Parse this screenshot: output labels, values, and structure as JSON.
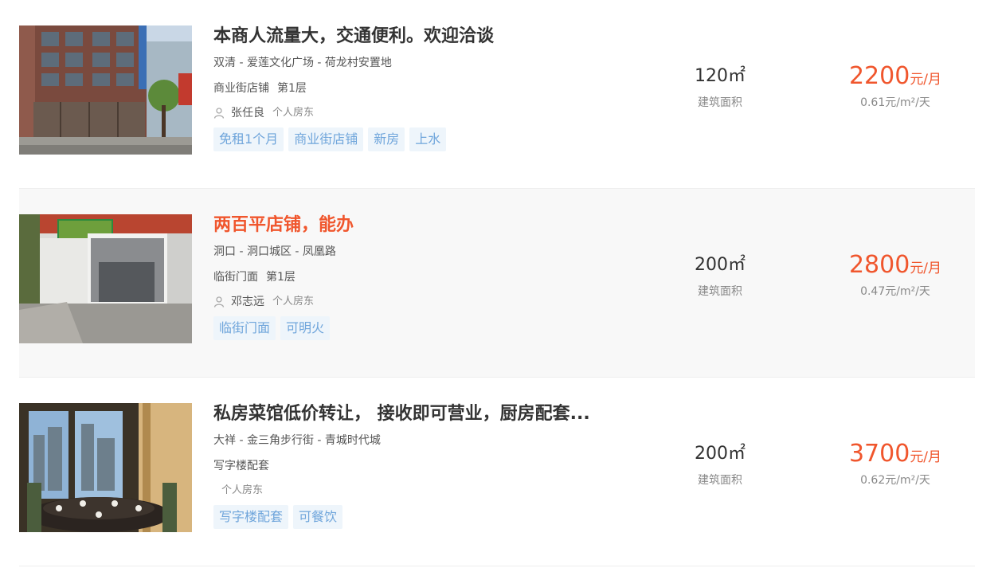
{
  "listings": [
    {
      "title": "本商人流量大，交通便利。欢迎洽谈",
      "address": "双清 - 爱莲文化广场 - 荷龙村安置地",
      "shop_type": "商业街店铺",
      "floor": "第1层",
      "owner_name": "张任良",
      "owner_type": "个人房东",
      "tags": [
        "免租1个月",
        "商业街店铺",
        "新房",
        "上水"
      ],
      "area": "120㎡",
      "area_label": "建筑面积",
      "price": "2200",
      "price_unit": "元/月",
      "unit_price": "0.61元/m²/天"
    },
    {
      "title": "两百平店铺，能办",
      "address": "洞口 - 洞口城区 - 凤凰路",
      "shop_type": "临街门面",
      "floor": "第1层",
      "owner_name": "邓志远",
      "owner_type": "个人房东",
      "tags": [
        "临街门面",
        "可明火"
      ],
      "area": "200㎡",
      "area_label": "建筑面积",
      "price": "2800",
      "price_unit": "元/月",
      "unit_price": "0.47元/m²/天"
    },
    {
      "title": "私房菜馆低价转让， 接收即可营业，厨房配套...",
      "address": "大祥 - 金三角步行街 - 青城时代城",
      "shop_type": "写字楼配套",
      "floor": "",
      "owner_name": "",
      "owner_type": "个人房东",
      "tags": [
        "写字楼配套",
        "可餐饮"
      ],
      "area": "200㎡",
      "area_label": "建筑面积",
      "price": "3700",
      "price_unit": "元/月",
      "unit_price": "0.62元/m²/天"
    }
  ],
  "colors": {
    "accent": "#f0562d",
    "tag_text": "#6fa5db",
    "tag_bg": "#eef5fb",
    "hover_bg": "#f8f8f8"
  },
  "icons": {
    "owner": "person-icon"
  }
}
